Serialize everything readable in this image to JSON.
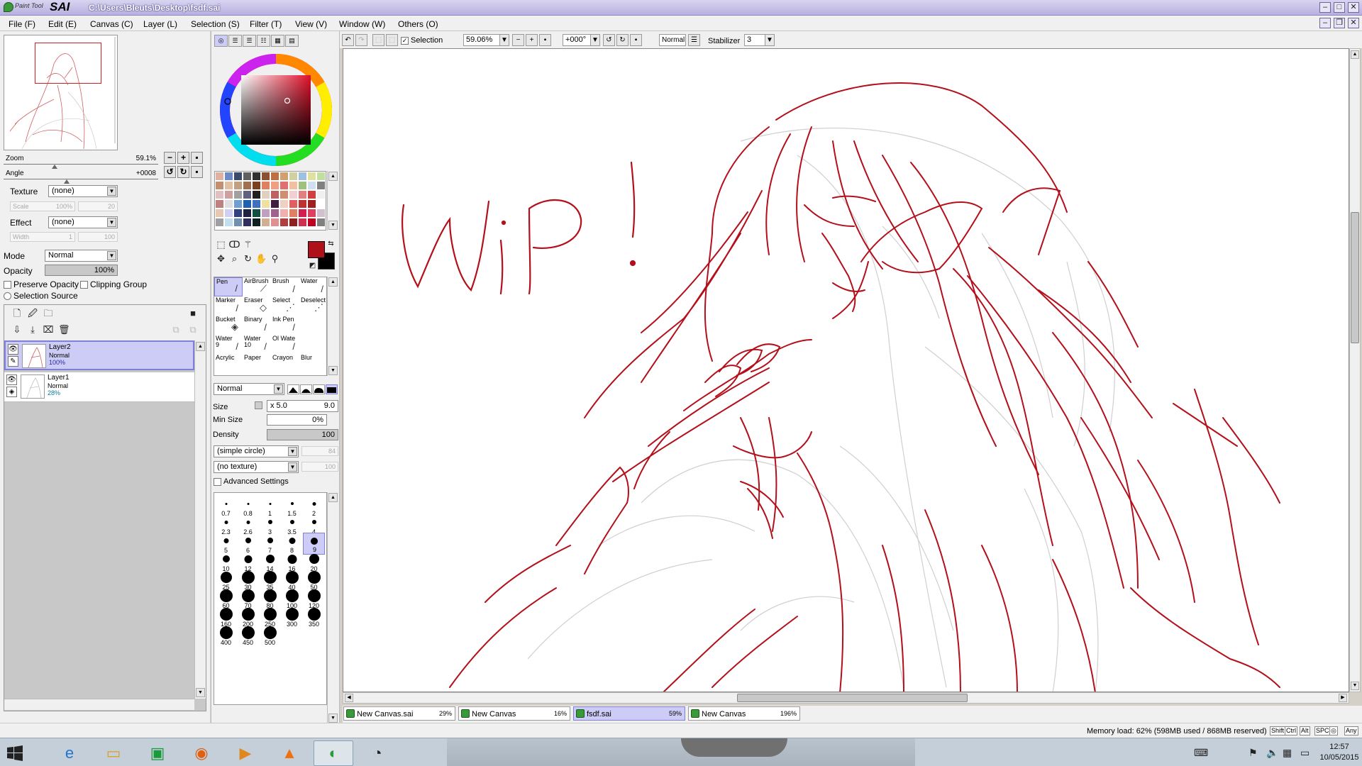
{
  "app": {
    "logo_small": "Paint Tool",
    "logo_big": "SAI",
    "window_path": "C:\\Users\\Bleuts\\Desktop\\fsdf.sai"
  },
  "menu": [
    "File (F)",
    "Edit (E)",
    "Canvas (C)",
    "Layer (L)",
    "Selection (S)",
    "Filter (T)",
    "View (V)",
    "Window (W)",
    "Others (O)"
  ],
  "navigator": {
    "zoom_label": "Zoom",
    "zoom_value": "59.1%",
    "angle_label": "Angle",
    "angle_value": "+0008",
    "zoom_fraction": 0.33,
    "angle_fraction": 0.41
  },
  "layer_props": {
    "texture_label": "Texture",
    "texture_value": "(none)",
    "scale_label": "Scale",
    "scale_value": "100%",
    "scale_num": "20",
    "effect_label": "Effect",
    "effect_value": "(none)",
    "width_label": "Width",
    "width_value": "1",
    "width_num": "100",
    "mode_label": "Mode",
    "mode_value": "Normal",
    "opacity_label": "Opacity",
    "opacity_value": "100%",
    "preserve_opacity": "Preserve Opacity",
    "clipping_group": "Clipping Group",
    "selection_source": "Selection Source"
  },
  "layers": [
    {
      "name": "Layer2",
      "mode": "Normal",
      "opacity": "100%",
      "selected": true
    },
    {
      "name": "Layer1",
      "mode": "Normal",
      "opacity": "28%",
      "selected": false
    }
  ],
  "colors": {
    "primary": "#b0101a",
    "secondary": "#000000",
    "accent": "#ccccf6",
    "title_bar": "#b8b0e0"
  },
  "palette": [
    "#e0b0a0",
    "#6a8aca",
    "#3a4a6a",
    "#606060",
    "#303030",
    "#8a5030",
    "#c07040",
    "#d0a070",
    "#d0d0a0",
    "#a0c0e0",
    "#e0e0a0",
    "#c0e0a0",
    "#c09070",
    "#e0c0a0",
    "#c0a080",
    "#a07050",
    "#7a4020",
    "#e08060",
    "#f0a080",
    "#e07070",
    "#f0c0a0",
    "#a0c080",
    "#d0e0f0",
    "#808080",
    "#e0c0c0",
    "#d0a0a0",
    "#a0a0a0",
    "#606080",
    "#202020",
    "#e0d0c0",
    "#c06060",
    "#d09070",
    "#f0d0d0",
    "#e08080",
    "#d04040",
    "#f0f0f0",
    "#c08080",
    "#e0e0e0",
    "#70a0d0",
    "#2060b0",
    "#4070c0",
    "#f0e0a0",
    "#402040",
    "#f0d0c0",
    "#e06060",
    "#c03030",
    "#a02020",
    "#ffffff",
    "#e8c8b0",
    "#d0d0f0",
    "#304080",
    "#202040",
    "#105040",
    "#c0a0c0",
    "#a06090",
    "#f0b0b0",
    "#e08060",
    "#d02050",
    "#e04060",
    "#d0c0d0",
    "#a0a0a0",
    "#c0e0f0",
    "#7090b0",
    "#303060",
    "#102020",
    "#d0b090",
    "#e09090",
    "#b04040",
    "#902020",
    "#d03050",
    "#c00020",
    "#808080"
  ],
  "brushes": [
    {
      "label": "Pen",
      "icon": "pen-icon",
      "glyph": "/",
      "selected": true
    },
    {
      "label": "AirBrush",
      "icon": "airbrush-icon",
      "glyph": "⟋"
    },
    {
      "label": "Brush",
      "icon": "brush-icon",
      "glyph": "/"
    },
    {
      "label": "Water",
      "icon": "water-icon",
      "glyph": "/"
    },
    {
      "label": "Marker",
      "icon": "marker-icon",
      "glyph": "/"
    },
    {
      "label": "Eraser",
      "icon": "eraser-icon",
      "glyph": "◇"
    },
    {
      "label": "Select",
      "icon": "select-icon",
      "glyph": "⋰"
    },
    {
      "label": "Deselect",
      "icon": "deselect-icon",
      "glyph": "⋰"
    },
    {
      "label": "Bucket",
      "icon": "bucket-icon",
      "glyph": "◈"
    },
    {
      "label": "Binary",
      "icon": "binary-icon",
      "glyph": "/"
    },
    {
      "label": "Ink Pen",
      "icon": "ink-pen-icon",
      "glyph": "/"
    },
    {
      "label": "",
      "icon": "",
      "glyph": ""
    },
    {
      "label": "Water\n9",
      "icon": "water-9-icon",
      "glyph": "/"
    },
    {
      "label": "Water\n10",
      "icon": "water-10-icon",
      "glyph": "/"
    },
    {
      "label": "Ol Wate",
      "icon": "oil-water-icon",
      "glyph": "/"
    },
    {
      "label": "",
      "icon": "",
      "glyph": ""
    },
    {
      "label": "Acrylic",
      "icon": "",
      "glyph": ""
    },
    {
      "label": "Paper",
      "icon": "",
      "glyph": ""
    },
    {
      "label": "Crayon",
      "icon": "",
      "glyph": ""
    },
    {
      "label": "Blur",
      "icon": "",
      "glyph": ""
    }
  ],
  "brush_settings": {
    "blend_mode": "Normal",
    "size_label": "Size",
    "size_mult": "x 5.0",
    "size_value": "9.0",
    "min_size_label": "Min Size",
    "min_size_value": "0%",
    "density_label": "Density",
    "density_value": "100",
    "shape": "(simple circle)",
    "shape_num": "84",
    "texture": "(no texture)",
    "texture_num": "100",
    "advanced": "Advanced Settings"
  },
  "brush_sizes": [
    "0.7",
    "0.8",
    "1",
    "1.5",
    "2",
    "2.3",
    "2.6",
    "3",
    "3.5",
    "4",
    "5",
    "6",
    "7",
    "8",
    "9",
    "10",
    "12",
    "14",
    "16",
    "20",
    "25",
    "30",
    "35",
    "40",
    "50",
    "60",
    "70",
    "80",
    "100",
    "120",
    "160",
    "200",
    "250",
    "300",
    "350",
    "400",
    "450",
    "500"
  ],
  "selected_brush_size": "9",
  "canvas_toolbar": {
    "selection_label": "Selection",
    "zoom": "59.06%",
    "angle": "+000°",
    "blend": "Normal",
    "stabilizer_label": "Stabilizer",
    "stabilizer_value": "3"
  },
  "canvas": {
    "wip_text": "WiP!"
  },
  "doc_tabs": [
    {
      "name": "New Canvas.sai",
      "pct": "29%",
      "active": false
    },
    {
      "name": "New Canvas",
      "pct": "16%",
      "active": false
    },
    {
      "name": "fsdf.sai",
      "pct": "59%",
      "active": true
    },
    {
      "name": "New Canvas",
      "pct": "196%",
      "active": false
    }
  ],
  "status": {
    "memory": "Memory load: 62% (598MB used / 868MB reserved)",
    "keys": [
      "Shift",
      "Ctrl",
      "Alt",
      "SPC",
      "◎",
      "Any"
    ]
  },
  "taskbar": {
    "apps": [
      {
        "name": "ie-icon",
        "glyph": "e"
      },
      {
        "name": "file-explorer-icon",
        "glyph": "▭"
      },
      {
        "name": "store-icon",
        "glyph": "▣"
      },
      {
        "name": "firefox-icon",
        "glyph": "◉"
      },
      {
        "name": "media-player-icon",
        "glyph": "▶"
      },
      {
        "name": "vlc-icon",
        "glyph": "▲"
      },
      {
        "name": "painttool-sai-icon",
        "glyph": "◐"
      },
      {
        "name": "osu-icon",
        "glyph": "◔"
      }
    ],
    "time": "12:57",
    "date": "10/05/2015"
  }
}
